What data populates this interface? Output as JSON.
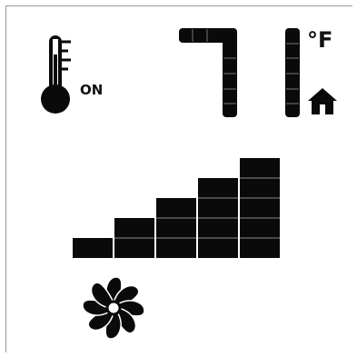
{
  "thermostat": {
    "mode_label": "ON",
    "temperature_digit_1": "7",
    "temperature_digit_2": "1",
    "unit_label": "°F"
  },
  "fan": {
    "speed_level": 5,
    "speed_levels_total": 5
  },
  "icons": {
    "thermometer": "thermometer-icon",
    "home": "home-icon",
    "fan": "fan-icon"
  },
  "colors": {
    "segment": "#0a0a0a",
    "background": "#ffffff"
  }
}
